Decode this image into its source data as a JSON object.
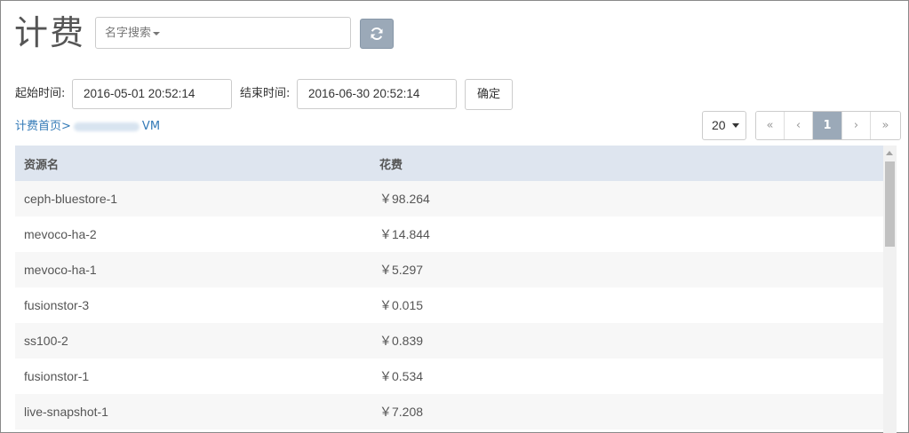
{
  "header": {
    "title": "计费"
  },
  "search": {
    "dropdown_label": "名字搜索"
  },
  "time_filter": {
    "start_label": "起始时间:",
    "start_value": "2016-05-01 20:52:14",
    "end_label": "结束时间:",
    "end_value": "2016-06-30 20:52:14",
    "confirm_label": "确定"
  },
  "breadcrumb": {
    "home": "计费首页",
    "separator": ">",
    "current": "VM"
  },
  "pager": {
    "page_size": "20",
    "first": "«",
    "prev": "‹",
    "current": "1",
    "next": "›",
    "last": "»"
  },
  "table": {
    "headers": [
      "资源名",
      "花费"
    ],
    "rows": [
      {
        "name": "ceph-bluestore-1",
        "cost": "￥98.264"
      },
      {
        "name": "mevoco-ha-2",
        "cost": "￥14.844"
      },
      {
        "name": "mevoco-ha-1",
        "cost": "￥5.297"
      },
      {
        "name": "fusionstor-3",
        "cost": "￥0.015"
      },
      {
        "name": "ss100-2",
        "cost": "￥0.839"
      },
      {
        "name": "fusionstor-1",
        "cost": "￥0.534"
      },
      {
        "name": "live-snapshot-1",
        "cost": "￥7.208"
      }
    ]
  },
  "colors": {
    "accent_button": "#9ba9b8",
    "header_bg": "#dee5ef",
    "link": "#337ab7"
  },
  "icons": {
    "refresh": "refresh-icon"
  }
}
